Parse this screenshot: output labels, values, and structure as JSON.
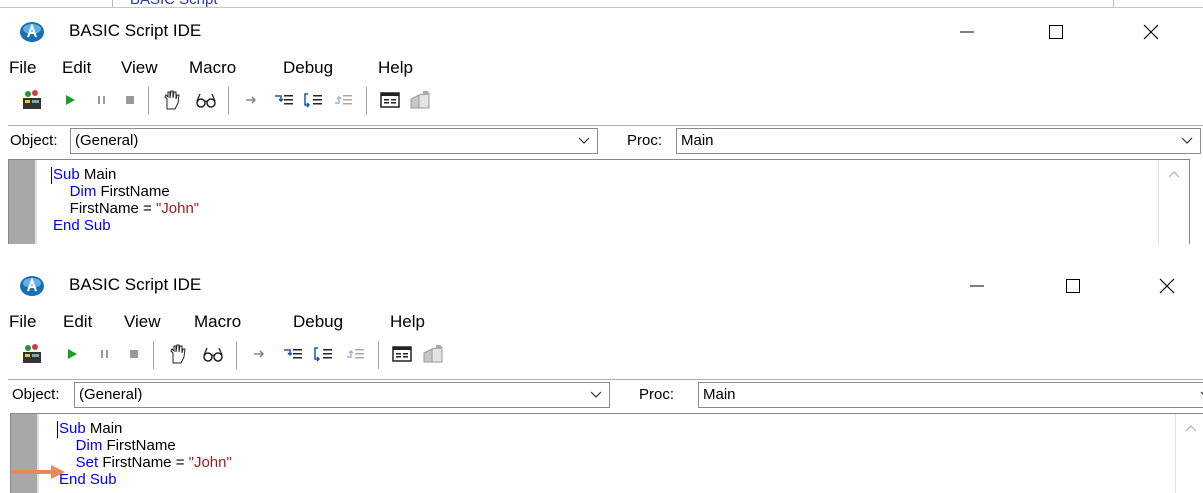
{
  "context": {
    "partial_title": "BASIC Script"
  },
  "windows": [
    {
      "title": "BASIC Script IDE",
      "menu": [
        "File",
        "Edit",
        "View",
        "Macro",
        "Debug",
        "Help"
      ],
      "object_label": "Object:",
      "object_value": "(General)",
      "proc_label": "Proc:",
      "proc_value": "Main",
      "code": {
        "line1_kw": "Sub",
        "line1_rest": " Main",
        "line2_kw": "Dim",
        "line2_rest": " FirstName",
        "line3_plain": "FirstName = ",
        "line3_str": "\"John\"",
        "line4_kw": "End Sub"
      }
    },
    {
      "title": "BASIC Script IDE",
      "menu": [
        "File",
        "Edit",
        "View",
        "Macro",
        "Debug",
        "Help"
      ],
      "object_label": "Object:",
      "object_value": "(General)",
      "proc_label": "Proc:",
      "proc_value": "Main",
      "code": {
        "line1_kw": "Sub",
        "line1_rest": " Main",
        "line2_kw": "Dim",
        "line2_rest": " FirstName",
        "line3_kw": "Set",
        "line3_plain": " FirstName = ",
        "line3_str": "\"John\"",
        "line4_kw": "End Sub"
      }
    }
  ],
  "colors": {
    "keyword": "#0000ee",
    "string": "#9b1c1c",
    "annotation_arrow": "#e8875a"
  },
  "toolbar_icons": [
    "debug-window-icon",
    "run-icon",
    "pause-icon",
    "stop-icon",
    "toggle-breakpoint-icon",
    "quick-watch-icon",
    "show-next-statement-icon",
    "step-into-icon",
    "step-over-icon",
    "step-out-icon",
    "user-dialog-icon",
    "references-icon"
  ]
}
